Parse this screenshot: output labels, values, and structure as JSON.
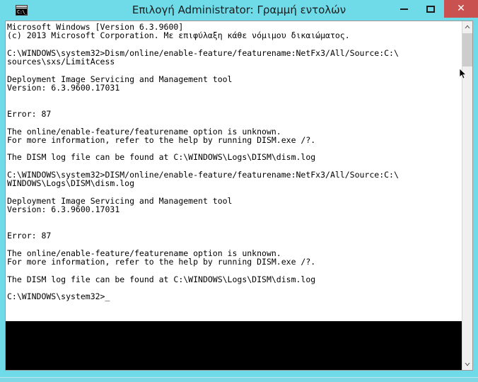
{
  "window": {
    "title": "Επιλογή Administrator: Γραμμή εντολών",
    "icon_name": "cmd-icon",
    "icon_text": "C:\\_",
    "titlebar_color": "#6fdbe8",
    "close_button_color": "#c9514f",
    "console_bg": "#ffffff",
    "console_fg": "#000000"
  },
  "caption": {
    "minimize_label": "Ελαχιστοποίηση",
    "maximize_label": "Μεγιστοποίηση",
    "close_label": "✕"
  },
  "console": {
    "lines": [
      "Microsoft Windows [Version 6.3.9600]",
      "(c) 2013 Microsoft Corporation. Με επιφύλαξη κάθε νόμιμου δικαιώματος.",
      "",
      "C:\\WINDOWS\\system32>Dism/online/enable-feature/featurename:NetFx3/All/Source:C:\\",
      "sources\\sxs/LimitAcess",
      "",
      "Deployment Image Servicing and Management tool",
      "Version: 6.3.9600.17031",
      "",
      "",
      "Error: 87",
      "",
      "The online/enable-feature/featurename option is unknown.",
      "For more information, refer to the help by running DISM.exe /?.",
      "",
      "The DISM log file can be found at C:\\WINDOWS\\Logs\\DISM\\dism.log",
      "",
      "C:\\WINDOWS\\system32>DISM/online/enable-feature/featurename:NetFx3/All/Source:C:\\",
      "WINDOWS\\Logs\\DISM\\dism.log",
      "",
      "Deployment Image Servicing and Management tool",
      "Version: 6.3.9600.17031",
      "",
      "",
      "Error: 87",
      "",
      "The online/enable-feature/featurename option is unknown.",
      "For more information, refer to the help by running DISM.exe /?.",
      "",
      "The DISM log file can be found at C:\\WINDOWS\\Logs\\DISM\\dism.log",
      "",
      "C:\\WINDOWS\\system32>_"
    ]
  },
  "scrollbar": {
    "up_arrow": "⌃",
    "down_arrow": "⌄",
    "thumb_position": "near-top"
  }
}
